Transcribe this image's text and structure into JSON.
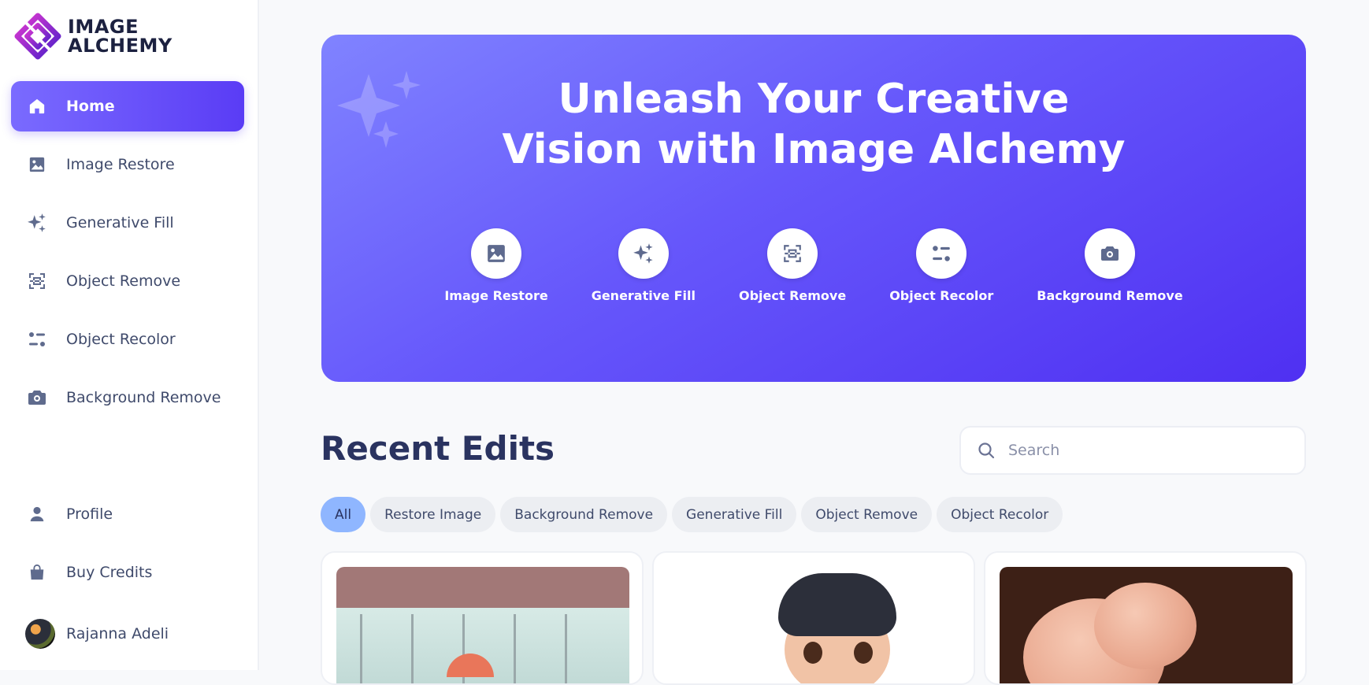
{
  "brand": {
    "line1": "IMAGE",
    "line2": "ALCHEMY"
  },
  "sidebar": {
    "items": [
      {
        "label": "Home",
        "icon": "home-icon"
      },
      {
        "label": "Image Restore",
        "icon": "image-icon"
      },
      {
        "label": "Generative Fill",
        "icon": "sparkles-icon"
      },
      {
        "label": "Object Remove",
        "icon": "scan-icon"
      },
      {
        "label": "Object Recolor",
        "icon": "sliders-icon"
      },
      {
        "label": "Background Remove",
        "icon": "camera-icon"
      }
    ],
    "bottom": [
      {
        "label": "Profile",
        "icon": "user-icon"
      },
      {
        "label": "Buy Credits",
        "icon": "bag-icon"
      }
    ],
    "user": {
      "name": "Rajanna Adeli"
    }
  },
  "hero": {
    "title_line1": "Unleash Your Creative",
    "title_line2": "Vision with Image Alchemy",
    "tools": [
      {
        "label": "Image Restore",
        "icon": "image-icon"
      },
      {
        "label": "Generative Fill",
        "icon": "sparkles-icon"
      },
      {
        "label": "Object Remove",
        "icon": "scan-icon"
      },
      {
        "label": "Object Recolor",
        "icon": "sliders-icon"
      },
      {
        "label": "Background Remove",
        "icon": "camera-icon"
      }
    ]
  },
  "recent": {
    "title": "Recent Edits",
    "search_placeholder": "Search",
    "filters": [
      "All",
      "Restore Image",
      "Background Remove",
      "Generative Fill",
      "Object Remove",
      "Object Recolor"
    ],
    "active_filter": "All"
  },
  "colors": {
    "accent": "#5a3cf5",
    "hero_start": "#8083ff",
    "hero_end": "#4f30f2",
    "active_chip": "#8fb6ff",
    "title": "#2a3360"
  }
}
